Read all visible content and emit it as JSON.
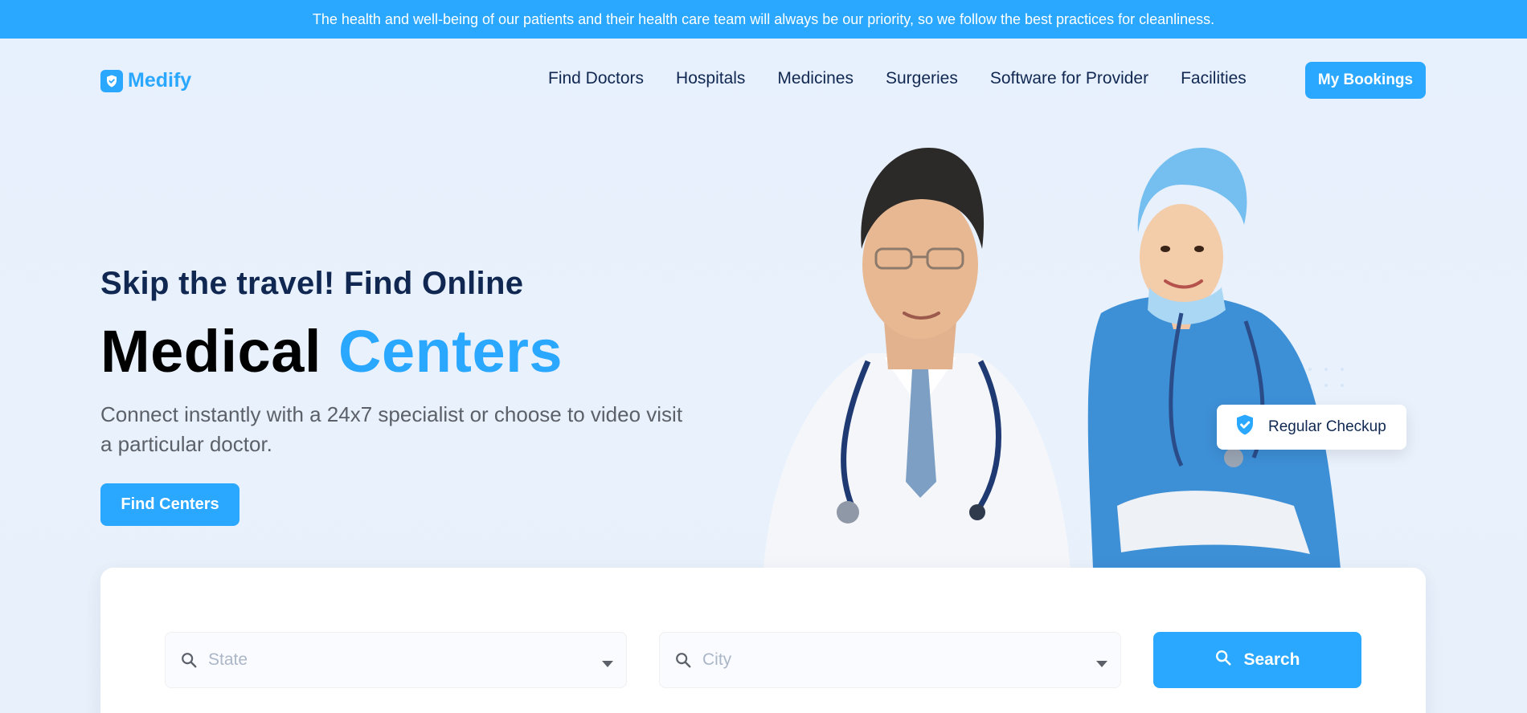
{
  "announcement": {
    "text": "The health and well-being of our patients and their health care team will always be our priority, so we follow the best practices for cleanliness."
  },
  "navbar": {
    "logo_text": "Medify",
    "links": [
      {
        "label": "Find Doctors"
      },
      {
        "label": "Hospitals"
      },
      {
        "label": "Medicines"
      },
      {
        "label": "Surgeries"
      },
      {
        "label": "Software for Provider"
      },
      {
        "label": "Facilities"
      }
    ],
    "bookings_label": "My Bookings"
  },
  "hero": {
    "subtitle": "Skip the travel! Find Online",
    "title_main": "Medical",
    "title_accent": "Centers",
    "description": "Connect instantly with a 24x7 specialist or choose to video visit a particular doctor.",
    "cta_label": "Find Centers",
    "badge_label": "Regular Checkup"
  },
  "search": {
    "state_placeholder": "State",
    "city_placeholder": "City",
    "button_label": "Search"
  },
  "colors": {
    "accent": "#2aa7ff",
    "navy": "#102851",
    "page_bg": "#e7f0fd"
  },
  "icons": [
    "shield-check-icon",
    "search-icon",
    "caret-down-icon"
  ]
}
